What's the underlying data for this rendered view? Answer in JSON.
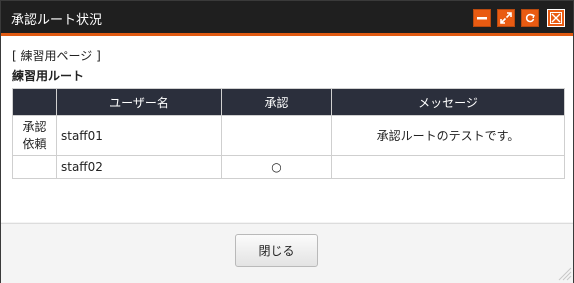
{
  "window": {
    "title": "承認ルート状況",
    "controls": [
      "minimize-icon",
      "maximize-icon",
      "refresh-icon",
      "close-icon"
    ],
    "accent_color": "#e95b12",
    "titlebar_color": "#1f1f1f"
  },
  "content": {
    "page_label": "[ 練習用ページ ]",
    "route_label": "練習用ルート",
    "table": {
      "headers": [
        "",
        "ユーザー名",
        "承認",
        "メッセージ"
      ],
      "rows": [
        {
          "type": "承認依頼",
          "user": "staff01",
          "approval": "",
          "message": "承認ルートのテストです。"
        },
        {
          "type": "",
          "user": "staff02",
          "approval": "○",
          "message": ""
        }
      ]
    }
  },
  "footer": {
    "close_label": "閉じる"
  }
}
